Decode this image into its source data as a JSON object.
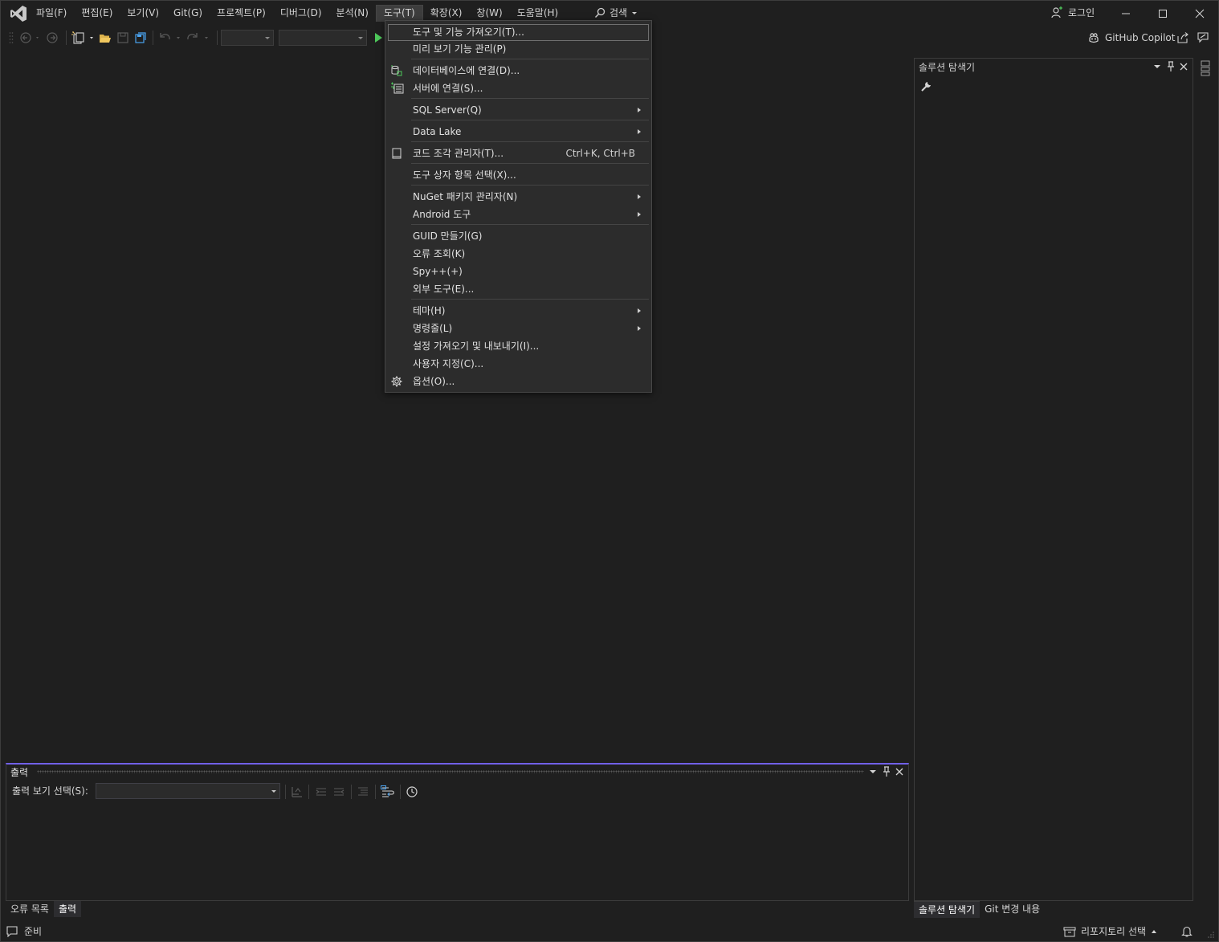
{
  "titlebar": {
    "menu": [
      "파일(F)",
      "편집(E)",
      "보기(V)",
      "Git(G)",
      "프로젝트(P)",
      "디버그(D)",
      "분석(N)",
      "도구(T)",
      "확장(X)",
      "창(W)",
      "도움말(H)"
    ],
    "active_menu": "도구(T)",
    "search_label": "검색",
    "login_label": "로그인",
    "copilot_label": "GitHub Copilot"
  },
  "tools_menu": {
    "items": [
      {
        "label": "도구 및 기능 가져오기(T)...",
        "highlighted": true
      },
      {
        "label": "미리 보기 기능 관리(P)"
      },
      {
        "label": "데이터베이스에 연결(D)...",
        "icon": "database-connect-icon"
      },
      {
        "label": "서버에 연결(S)...",
        "icon": "server-connect-icon"
      },
      {
        "label": "SQL Server(Q)",
        "submenu": true
      },
      {
        "label": "Data Lake",
        "submenu": true
      },
      {
        "label": "코드 조각 관리자(T)...",
        "shortcut": "Ctrl+K, Ctrl+B",
        "icon": "snippet-icon"
      },
      {
        "label": "도구 상자 항목 선택(X)..."
      },
      {
        "label": "NuGet 패키지 관리자(N)",
        "submenu": true
      },
      {
        "label": "Android 도구",
        "submenu": true
      },
      {
        "label": "GUID 만들기(G)"
      },
      {
        "label": "오류 조회(K)"
      },
      {
        "label": "Spy++(+)"
      },
      {
        "label": "외부 도구(E)..."
      },
      {
        "label": "테마(H)",
        "submenu": true
      },
      {
        "label": "명령줄(L)",
        "submenu": true
      },
      {
        "label": "설정 가져오기 및 내보내기(I)..."
      },
      {
        "label": "사용자 지정(C)..."
      },
      {
        "label": "옵션(O)...",
        "icon": "gear-icon"
      }
    ]
  },
  "solution_explorer": {
    "title": "솔루션 탐색기",
    "tabs": [
      "솔루션 탐색기",
      "Git 변경 내용"
    ]
  },
  "output_panel": {
    "title": "출력",
    "source_label": "출력 보기 선택(S):",
    "tabs": [
      "오류 목록",
      "출력"
    ]
  },
  "statusbar": {
    "ready": "준비",
    "repo": "리포지토리 선택"
  },
  "colors": {
    "background": "#1f1f1f",
    "accent": "#7160e8",
    "run": "#4ec95b"
  }
}
